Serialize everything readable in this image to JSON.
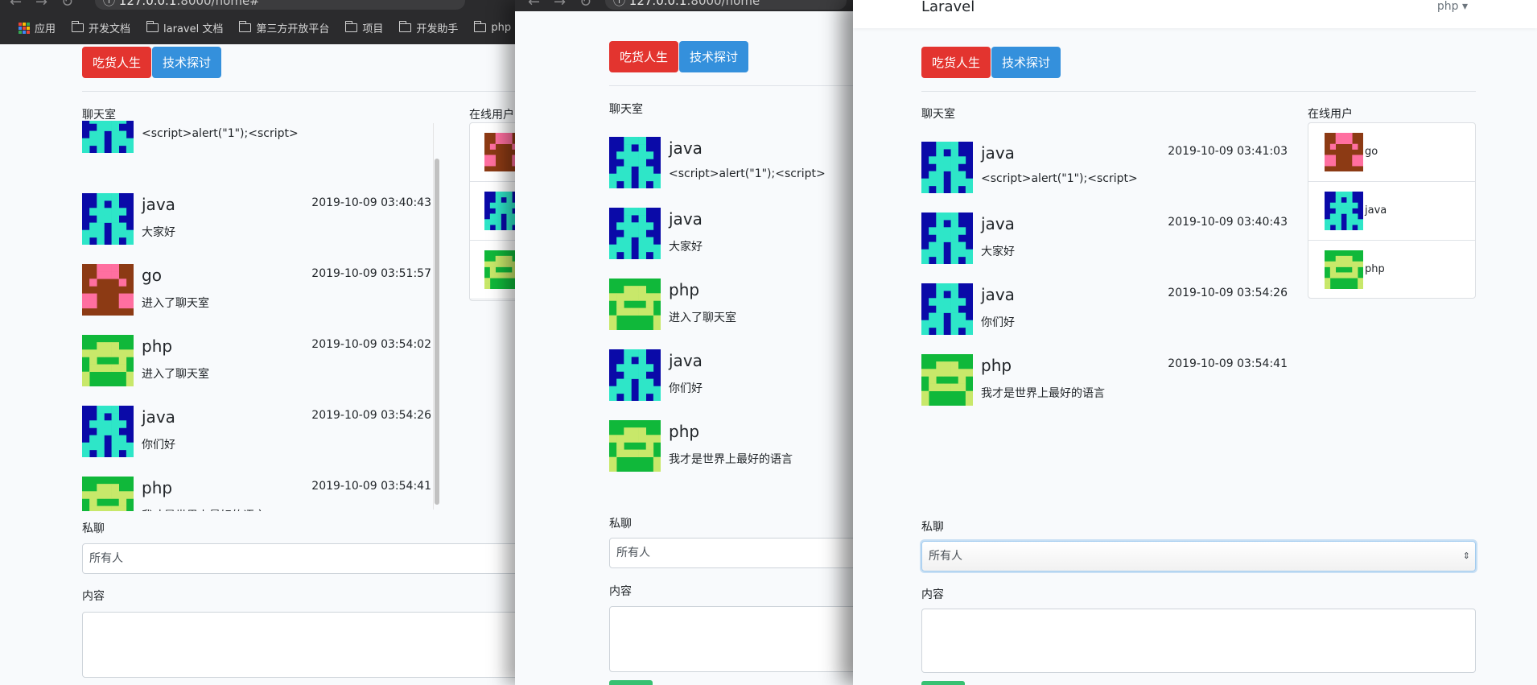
{
  "browser": {
    "url_host": "127.0.0.1",
    "url_path": ":8000/home#",
    "url_path_home": ":8000/home",
    "nav": {
      "back": "←",
      "forward": "→",
      "reload": "↻",
      "info": "ⓘ"
    },
    "bookmarks": [
      {
        "label": "应用",
        "icon": "apps-grid-icon"
      },
      {
        "label": "开发文档",
        "icon": "folder-icon"
      },
      {
        "label": "laravel 文档",
        "icon": "folder-icon"
      },
      {
        "label": "第三方开放平台",
        "icon": "folder-icon"
      },
      {
        "label": "项目",
        "icon": "folder-icon"
      },
      {
        "label": "开发助手",
        "icon": "folder-icon"
      },
      {
        "label": "php",
        "icon": "folder-icon"
      }
    ]
  },
  "colors": {
    "red": "#e3342f",
    "blue": "#3490dc",
    "avatar_blue_bg": "#0a0aa8",
    "avatar_blue_fg": "#2ee6c8",
    "avatar_green_bg": "#10b83a",
    "avatar_green_fg": "#c8e86a",
    "avatar_brown_bg": "#8c3a14",
    "avatar_brown_fg": "#ff6fa0"
  },
  "app": {
    "brand": "Laravel",
    "user_menu": "php",
    "caret": "▾",
    "buttons": {
      "food": "吃货人生",
      "tech": "技术探讨"
    },
    "labels": {
      "chatroom": "聊天室",
      "online_users": "在线用户",
      "online_users_cut": "在线用户",
      "private": "私聊",
      "content": "内容"
    },
    "select_value": "所有人",
    "spinner": "⇕"
  },
  "panel1": {
    "messages": [
      {
        "name": "",
        "time": "",
        "text": "<script>alert(\"1\");<script>",
        "avatar": "blue"
      },
      {
        "name": "java",
        "time": "2019-10-09 03:40:43",
        "text": "大家好",
        "avatar": "blue"
      },
      {
        "name": "go",
        "time": "2019-10-09 03:51:57",
        "text": "进入了聊天室",
        "avatar": "brown"
      },
      {
        "name": "php",
        "time": "2019-10-09 03:54:02",
        "text": "进入了聊天室",
        "avatar": "green"
      },
      {
        "name": "java",
        "time": "2019-10-09 03:54:26",
        "text": "你们好",
        "avatar": "blue"
      },
      {
        "name": "php",
        "time": "2019-10-09 03:54:41",
        "text": "我才是世界上最好的语言",
        "avatar": "green"
      }
    ],
    "users": [
      {
        "avatar": "brown"
      },
      {
        "avatar": "blue"
      },
      {
        "avatar": "green"
      }
    ]
  },
  "panel2": {
    "messages": [
      {
        "name": "java",
        "text": "<script>alert(\"1\");<script>",
        "avatar": "blue"
      },
      {
        "name": "java",
        "text": "大家好",
        "avatar": "blue"
      },
      {
        "name": "php",
        "text": "进入了聊天室",
        "avatar": "green"
      },
      {
        "name": "java",
        "text": "你们好",
        "avatar": "blue"
      },
      {
        "name": "php",
        "text": "我才是世界上最好的语言",
        "avatar": "green"
      }
    ]
  },
  "panel3": {
    "messages": [
      {
        "name": "java",
        "time": "2019-10-09 03:41:03",
        "text": "<script>alert(\"1\");<script>",
        "avatar": "blue"
      },
      {
        "name": "java",
        "time": "2019-10-09 03:40:43",
        "text": "大家好",
        "avatar": "blue"
      },
      {
        "name": "java",
        "time": "2019-10-09 03:54:26",
        "text": "你们好",
        "avatar": "blue"
      },
      {
        "name": "php",
        "time": "2019-10-09 03:54:41",
        "text": "我才是世界上最好的语言",
        "avatar": "green"
      }
    ],
    "users": [
      {
        "name": "go",
        "avatar": "brown"
      },
      {
        "name": "java",
        "avatar": "blue"
      },
      {
        "name": "php",
        "avatar": "green"
      }
    ]
  }
}
